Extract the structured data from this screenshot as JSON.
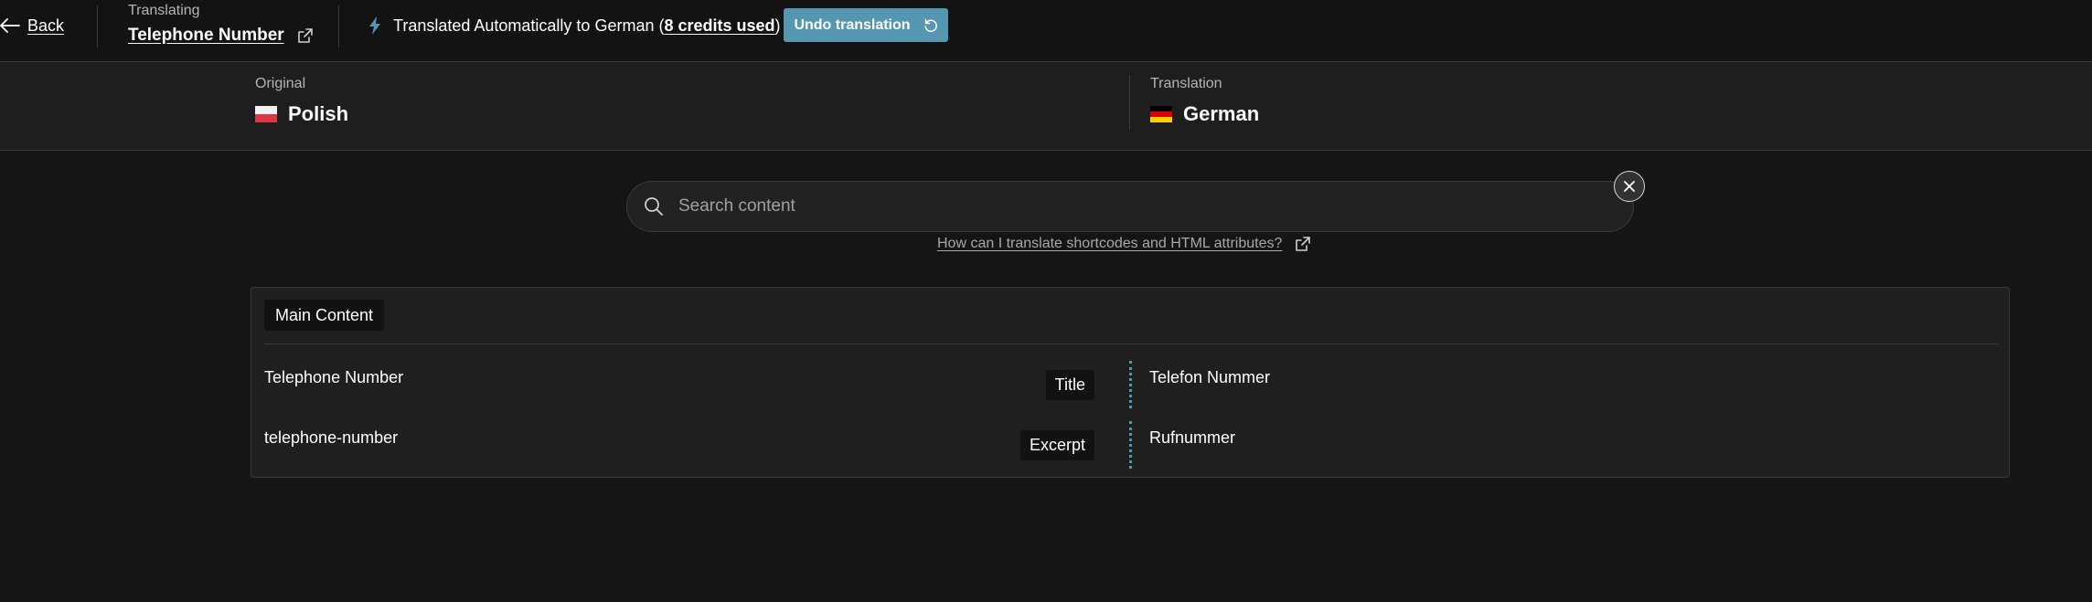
{
  "topbar": {
    "back_label": "Back",
    "translating_label": "Translating",
    "post_title": "Telephone Number",
    "status_prefix": "Translated Automatically to German (",
    "credits_text": "8 credits used",
    "status_suffix": ")",
    "undo_label": "Undo translation"
  },
  "languages": {
    "original_caption": "Original",
    "original_name": "Polish",
    "translation_caption": "Translation",
    "translation_name": "German"
  },
  "search": {
    "placeholder": "Search content",
    "help_text": "How can I translate shortcodes and HTML attributes?"
  },
  "content": {
    "section_label": "Main Content",
    "rows": [
      {
        "original": "Telephone Number",
        "field": "Title",
        "translation": "Telefon Nummer"
      },
      {
        "original": "telephone-number",
        "field": "Excerpt",
        "translation": "Rufnummer"
      }
    ]
  },
  "colors": {
    "accent": "#5596b0",
    "background": "#151515",
    "panel": "#1e1e1e"
  },
  "icons": {
    "back": "arrow-left-icon",
    "external": "external-link-icon",
    "bolt": "lightning-bolt-icon",
    "undo": "undo-icon",
    "search": "search-icon",
    "clear": "close-icon",
    "flag_pl": "flag-poland-icon",
    "flag_de": "flag-germany-icon"
  }
}
